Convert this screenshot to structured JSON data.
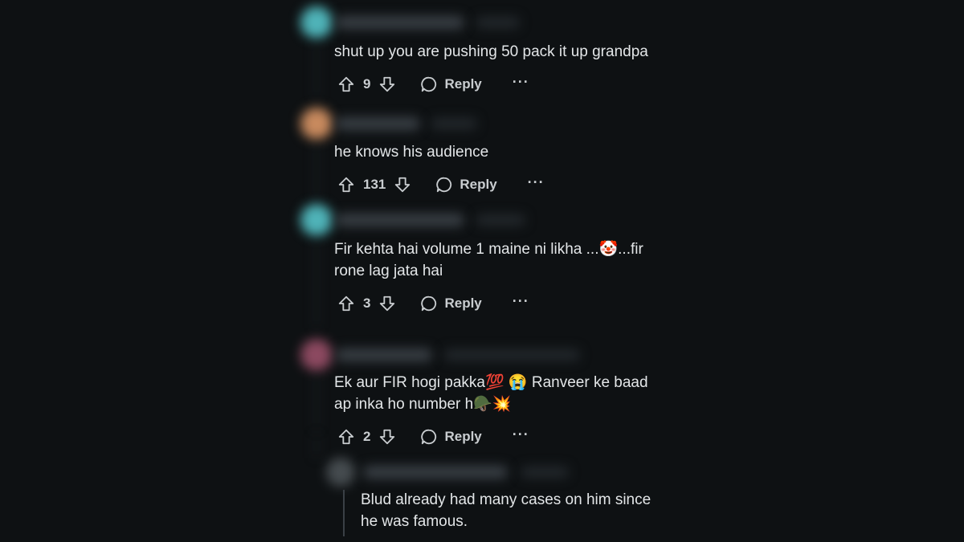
{
  "comments": [
    {
      "text": "shut up you are pushing 50 pack it up grandpa",
      "score": "9",
      "reply_label": "Reply",
      "more_label": "···",
      "avatar_color": "#4fb3b8"
    },
    {
      "text": "he knows his audience",
      "score": "131",
      "reply_label": "Reply",
      "more_label": "···",
      "avatar_color": "#c88a5e"
    },
    {
      "text": "Fir kehta hai volume 1 maine ni likha ...🤡...fir\nrone lag jata hai",
      "score": "3",
      "reply_label": "Reply",
      "more_label": "···",
      "avatar_color": "#4fb3b8"
    },
    {
      "text": "Ek aur FIR hogi pakka💯 😭 Ranveer ke baad\nap inka ho number h🪖💥",
      "score": "2",
      "reply_label": "Reply",
      "more_label": "···",
      "avatar_color": "#b65c7a"
    }
  ],
  "reply": {
    "text": "Blud already had many cases on him since\nhe was famous.",
    "avatar_color": "#6b7378"
  },
  "colors": {
    "background": "#0e1113",
    "text": "#e3e6e8",
    "action_text": "#c9cdd0"
  },
  "icons": [
    "upvote-icon",
    "downvote-icon",
    "comment-bubble-icon",
    "more-options-icon"
  ]
}
